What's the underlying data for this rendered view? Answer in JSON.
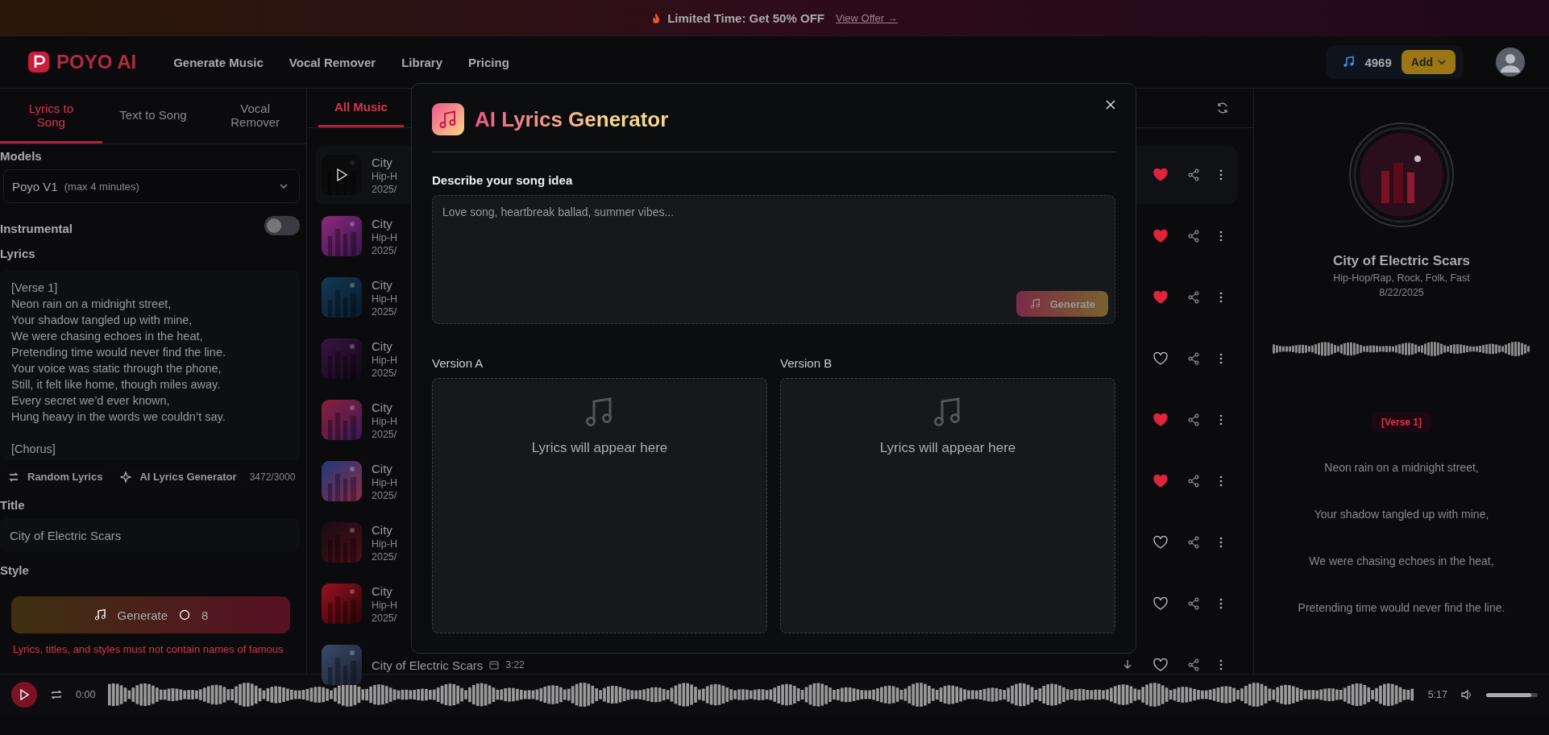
{
  "promo_banner": {
    "text": "Limited Time: Get 50% OFF",
    "link": "View Offer →"
  },
  "header": {
    "logo": "POYO AI",
    "nav": [
      {
        "label": "Generate Music"
      },
      {
        "label": "Vocal Remover"
      },
      {
        "label": "Library"
      },
      {
        "label": "Pricing"
      }
    ],
    "credits": "4969",
    "add_button": "Add"
  },
  "left_panel": {
    "tabs": [
      {
        "label": "Lyrics to Song",
        "selected": true
      },
      {
        "label": "Text to Song",
        "selected": false
      },
      {
        "label": "Vocal Remover",
        "selected": false
      }
    ],
    "models_label": "Models",
    "model": {
      "name": "Poyo V1",
      "note": "(max 4 minutes)"
    },
    "instrumental": {
      "label": "Instrumental",
      "on": false
    },
    "lyrics_label": "Lyrics",
    "lyrics": [
      [
        "[Verse 1]",
        "Neon rain on a midnight street,",
        "Your shadow tangled up with mine,",
        "We were chasing echoes in the heat,",
        "Pretending time would never find the line.",
        "Your voice was static through the phone,",
        "Still, it felt like home, though miles away.",
        "Every secret we’d ever known,",
        "Hung heavy in the words we couldn’t say."
      ],
      [
        "[Chorus]"
      ]
    ],
    "lyrics_buttons": [
      "Random Lyrics",
      "AI Lyrics Generator"
    ],
    "char_count": "3472/3000",
    "title_label": "Title",
    "title_value": "City of Electric Scars",
    "style_label": "Style",
    "generate_button": {
      "label": "Generate",
      "cost": "8"
    },
    "warning": "Lyrics, titles, and styles must not contain names of famous"
  },
  "library": {
    "tabs": [
      {
        "label": "All Music",
        "selected": true
      }
    ],
    "rows": [
      {
        "title": "City",
        "genre": "Hip-H",
        "date": "2025/",
        "liked": true,
        "playing": true
      },
      {
        "title": "City",
        "genre": "Hip-H",
        "date": "2025/",
        "liked": true,
        "playing": false
      },
      {
        "title": "City",
        "genre": "Hip-H",
        "date": "2025/",
        "liked": true,
        "playing": false
      },
      {
        "title": "City",
        "genre": "Hip-H",
        "date": "2025/",
        "liked": false,
        "playing": false
      },
      {
        "title": "City",
        "genre": "Hip-H",
        "date": "2025/",
        "liked": true,
        "playing": false
      },
      {
        "title": "City",
        "genre": "Hip-H",
        "date": "2025/",
        "liked": true,
        "playing": false
      },
      {
        "title": "City",
        "genre": "Hip-H",
        "date": "2025/",
        "liked": false,
        "playing": false
      },
      {
        "title": "City",
        "genre": "Hip-H",
        "date": "2025/",
        "liked": false,
        "playing": false
      },
      {
        "title": "City of Electric Scars",
        "duration": "3:22",
        "liked": false,
        "playing": false,
        "download": true
      }
    ]
  },
  "now_playing": {
    "title": "City of Electric Scars",
    "genres": "Hip-Hop/Rap, Rock, Folk, Fast",
    "date": "8/22/2025",
    "section": "[Verse 1]",
    "lines": [
      "Neon rain on a midnight street,",
      "Your shadow tangled up with mine,",
      "We were chasing echoes in the heat,",
      "Pretending time would never find the line."
    ]
  },
  "player": {
    "current": "0:00",
    "total": "5:17",
    "volume": {
      "level": 0.88
    }
  },
  "modal": {
    "title": "AI Lyrics Generator",
    "prompt_label": "Describe your song idea",
    "prompt_placeholder": "Love song, heartbreak ballad, summer vibes...",
    "generate_button": {
      "label": "Generate",
      "disabled": true
    },
    "versions": [
      {
        "label": "Version A",
        "placeholder": "Lyrics will appear here"
      },
      {
        "label": "Version B",
        "placeholder": "Lyrics will appear here"
      }
    ]
  }
}
